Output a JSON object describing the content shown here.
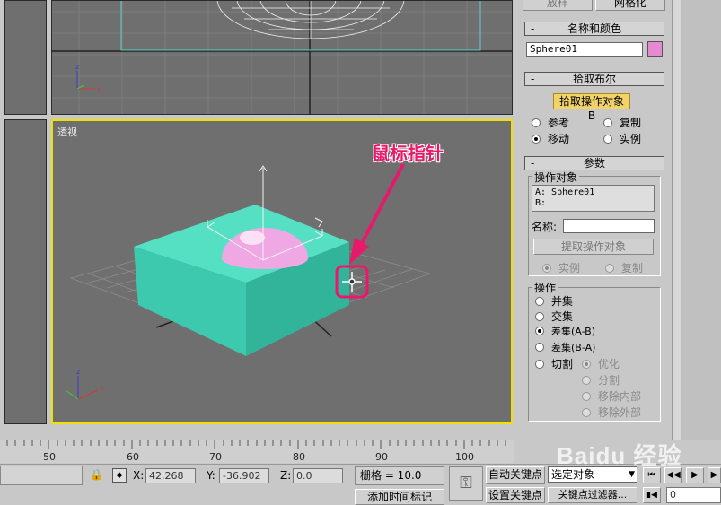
{
  "viewport": {
    "top_buttons": [
      "放样",
      "网格化"
    ],
    "perspective_label": "透视",
    "annotation": "鼠标指针"
  },
  "name_color": {
    "title": "名称和颜色",
    "name_value": "Sphere01",
    "color": "#e58ad0"
  },
  "pick_boolean": {
    "title": "拾取布尔",
    "pick_button": "拾取操作对象 B",
    "options": [
      "参考",
      "复制",
      "移动",
      "实例"
    ],
    "selected": "移动"
  },
  "params": {
    "title": "参数",
    "operands_group": "操作对象",
    "operand_a": "A: Sphere01",
    "operand_b": "B:",
    "name_label": "名称:",
    "name_value": "",
    "extract_button": "提取操作对象",
    "extract_options": [
      "实例",
      "复制"
    ],
    "extract_selected": "实例",
    "ops_group": "操作",
    "operations": [
      "并集",
      "交集",
      "差集(A-B)",
      "差集(B-A)",
      "切割"
    ],
    "selected_operation": "差集(A-B)",
    "cut_options": [
      "优化",
      "分割",
      "移除内部",
      "移除外部"
    ],
    "cut_selected": "优化"
  },
  "timeline": {
    "ticks": [
      "50",
      "60",
      "70",
      "80",
      "90",
      "100"
    ]
  },
  "status": {
    "x_label": "X:",
    "x_value": "42.268",
    "y_label": "Y:",
    "y_value": "-36.902",
    "z_label": "Z:",
    "z_value": "0.0",
    "grid": "栅格 = 10.0",
    "add_time_tag": "添加时间标记",
    "auto_key": "自动关键点",
    "set_key": "设置关键点",
    "selection_set": "选定对象",
    "key_filters": "关键点过滤器...",
    "frame": "0"
  },
  "watermark": "Baidu 经验"
}
